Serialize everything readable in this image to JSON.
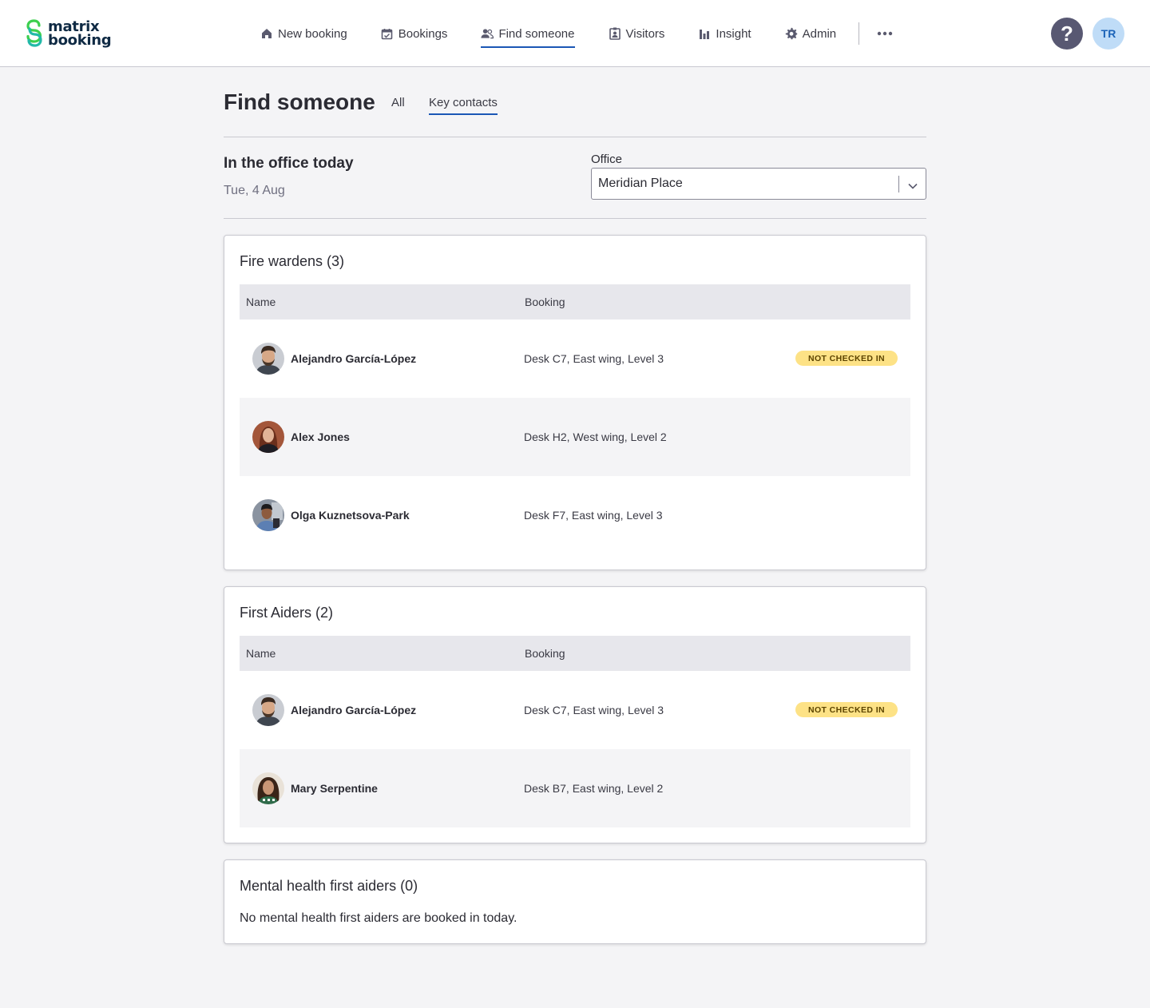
{
  "brand": {
    "line1": "matrix",
    "line2": "booking"
  },
  "nav": {
    "items": [
      {
        "label": "New booking",
        "icon": "home-icon"
      },
      {
        "label": "Bookings",
        "icon": "calendar-check-icon"
      },
      {
        "label": "Find someone",
        "icon": "people-icon",
        "active": true
      },
      {
        "label": "Visitors",
        "icon": "visitor-badge-icon"
      },
      {
        "label": "Insight",
        "icon": "bar-chart-icon"
      },
      {
        "label": "Admin",
        "icon": "gear-icon"
      }
    ],
    "more_icon": "more-horizontal-icon"
  },
  "header": {
    "help_label": "?",
    "user_initials": "TR"
  },
  "page": {
    "title": "Find someone",
    "tabs": [
      {
        "label": "All"
      },
      {
        "label": "Key contacts",
        "active": true
      }
    ]
  },
  "office": {
    "heading": "In the office today",
    "date": "Tue, 4 Aug",
    "field_label": "Office",
    "selected": "Meridian Place"
  },
  "sections": [
    {
      "title": "Fire wardens (3)",
      "columns": [
        "Name",
        "Booking"
      ],
      "rows": [
        {
          "name": "Alejandro García-López",
          "booking": "Desk C7, East wing, Level 3",
          "badge": "NOT CHECKED IN"
        },
        {
          "name": "Alex Jones",
          "booking": "Desk H2, West wing, Level 2"
        },
        {
          "name": "Olga Kuznetsova-Park",
          "booking": "Desk F7, East wing, Level 3"
        }
      ]
    },
    {
      "title": "First Aiders (2)",
      "columns": [
        "Name",
        "Booking"
      ],
      "rows": [
        {
          "name": "Alejandro García-López",
          "booking": "Desk C7, East wing, Level 3",
          "badge": "NOT CHECKED IN"
        },
        {
          "name": "Mary Serpentine",
          "booking": "Desk B7, East wing, Level 2"
        }
      ]
    },
    {
      "title": "Mental health first aiders (0)",
      "empty_message": "No mental health first aiders are booked in today."
    }
  ],
  "colors": {
    "accent": "#1b57b5",
    "badge_bg": "#fde286",
    "help_bg": "#585872",
    "avatar_bg": "#bfdcf7",
    "logo_green": "#3ccf4e"
  }
}
